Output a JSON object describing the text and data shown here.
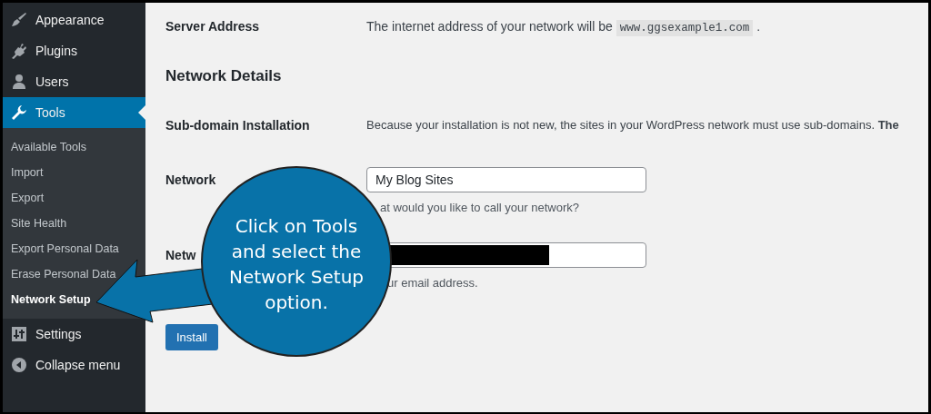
{
  "sidebar": {
    "items": [
      {
        "label": "Appearance",
        "selected": false
      },
      {
        "label": "Plugins",
        "selected": false
      },
      {
        "label": "Users",
        "selected": false
      },
      {
        "label": "Tools",
        "selected": true,
        "submenu": [
          {
            "label": "Available Tools",
            "selected": false
          },
          {
            "label": "Import",
            "selected": false
          },
          {
            "label": "Export",
            "selected": false
          },
          {
            "label": "Site Health",
            "selected": false
          },
          {
            "label": "Export Personal Data",
            "selected": false
          },
          {
            "label": "Erase Personal Data",
            "selected": false
          },
          {
            "label": "Network Setup",
            "selected": true
          }
        ]
      },
      {
        "label": "Settings",
        "selected": false
      },
      {
        "label": "Collapse menu",
        "selected": false
      }
    ]
  },
  "form": {
    "server_address": {
      "label": "Server Address",
      "text": "The internet address of your network will be",
      "address": "www.ggsexample1.com",
      "after": "."
    },
    "heading": "Network Details",
    "subdomain": {
      "label": "Sub-domain Installation",
      "text": "Because your installation is not new, the sites in your WordPress network must use sub-domains. **The**"
    },
    "fields": [
      {
        "label": "Network",
        "value": "My Blog Sites",
        "hint": "at would you like to call your network?",
        "redacted": false
      },
      {
        "label": "Netw",
        "hint": "ur email address.",
        "redacted": true
      }
    ],
    "button": "Install"
  },
  "callout": {
    "text": "Click on Tools and select the Network Setup option."
  }
}
